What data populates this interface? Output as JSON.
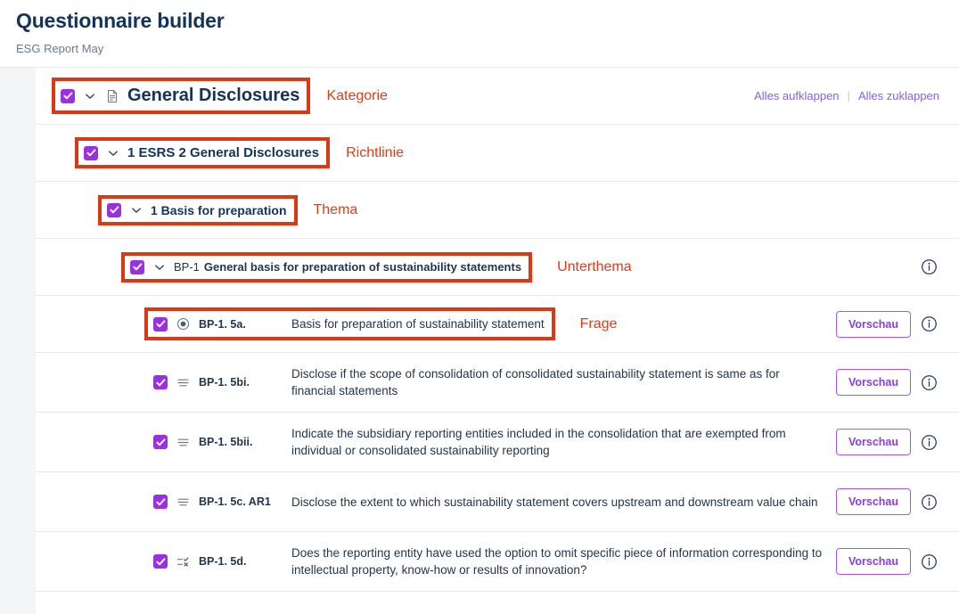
{
  "header": {
    "title": "Questionnaire builder",
    "subtitle": "ESG Report May"
  },
  "toolbar": {
    "expand_all": "Alles aufklappen",
    "collapse_all": "Alles zuklappen",
    "separator": "|"
  },
  "labels": {
    "preview": "Vorschau"
  },
  "annotations": {
    "category": "Kategorie",
    "directive": "Richtlinie",
    "topic": "Thema",
    "subtopic": "Unterthema",
    "question": "Frage"
  },
  "tree": {
    "category": {
      "label": "General Disclosures",
      "icon": "document-icon",
      "checked": true,
      "expanded": true
    },
    "directive": {
      "label": "1 ESRS 2 General Disclosures",
      "checked": true,
      "expanded": true
    },
    "topic": {
      "label": "1 Basis for preparation",
      "checked": true,
      "expanded": true
    },
    "subtopic": {
      "code": "BP-1",
      "label": "General basis for preparation of sustainability statements",
      "checked": true,
      "expanded": true
    },
    "questions": [
      {
        "code": "BP-1. 5a.",
        "text": "Basis for preparation of sustainability statement",
        "icon": "radio-button-icon",
        "checked": true,
        "highlighted": true,
        "annotation": "Frage"
      },
      {
        "code": "BP-1. 5bi.",
        "text": "Disclose if the scope of consolidation of consolidated sustainability statement is same as for financial statements",
        "icon": "text-lines-icon",
        "checked": true,
        "highlighted": false
      },
      {
        "code": "BP-1. 5bii.",
        "text": "Indicate the subsidiary reporting entities included in the consolidation that are exempted from individual or consolidated sustainability reporting",
        "icon": "text-lines-icon",
        "checked": true,
        "highlighted": false
      },
      {
        "code": "BP-1. 5c. AR1",
        "text": "Disclose the extent to which sustainability statement covers upstream and downstream value chain",
        "icon": "text-lines-icon",
        "checked": true,
        "highlighted": false
      },
      {
        "code": "BP-1. 5d.",
        "text": "Does the reporting entity have used the option to omit specific piece of information corresponding to intellectual property, know-how or results of innovation?",
        "icon": "choice-list-icon",
        "checked": true,
        "highlighted": false
      }
    ]
  },
  "colors": {
    "checkbox_purple": "#9b30e0",
    "accent_purple": "#8b5cf6",
    "annotation_red": "#e03c17",
    "title_navy": "#12335c",
    "page_bg": "#f4f5f7"
  }
}
